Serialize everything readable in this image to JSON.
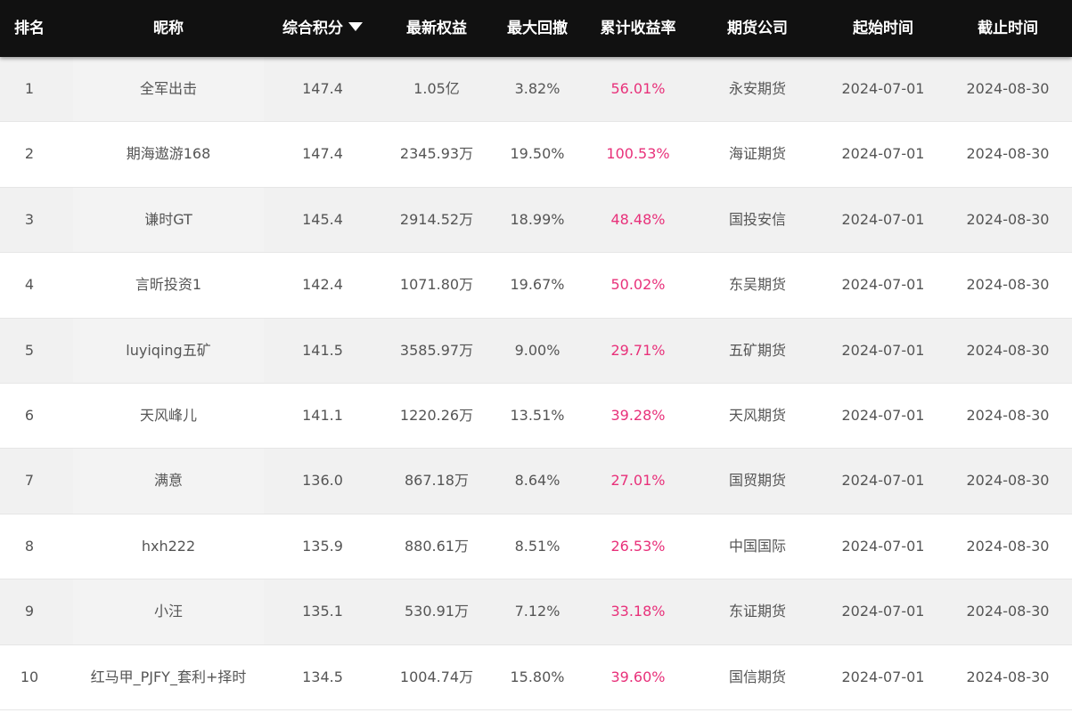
{
  "header": {
    "rank": "排名",
    "nickname": "昵称",
    "score": "综合积分",
    "equity": "最新权益",
    "max_drawdown": "最大回撤",
    "return": "累计收益率",
    "company": "期货公司",
    "start": "起始时间",
    "end": "截止时间",
    "sort_icon": "caret-down-icon"
  },
  "colors": {
    "header_bg": "#111111",
    "row_alt_bg": "#f1f1f1",
    "return_text": "#e8317a",
    "body_text": "#555555"
  },
  "rows": [
    {
      "rank": "1",
      "nickname": "全军出击",
      "score": "147.4",
      "equity": "1.05亿",
      "max_drawdown": "3.82%",
      "return": "56.01%",
      "company": "永安期货",
      "start": "2024-07-01",
      "end": "2024-08-30"
    },
    {
      "rank": "2",
      "nickname": "期海遨游168",
      "score": "147.4",
      "equity": "2345.93万",
      "max_drawdown": "19.50%",
      "return": "100.53%",
      "company": "海证期货",
      "start": "2024-07-01",
      "end": "2024-08-30"
    },
    {
      "rank": "3",
      "nickname": "谦时GT",
      "score": "145.4",
      "equity": "2914.52万",
      "max_drawdown": "18.99%",
      "return": "48.48%",
      "company": "国投安信",
      "start": "2024-07-01",
      "end": "2024-08-30"
    },
    {
      "rank": "4",
      "nickname": "言昕投资1",
      "score": "142.4",
      "equity": "1071.80万",
      "max_drawdown": "19.67%",
      "return": "50.02%",
      "company": "东吴期货",
      "start": "2024-07-01",
      "end": "2024-08-30"
    },
    {
      "rank": "5",
      "nickname": "luyiqing五矿",
      "score": "141.5",
      "equity": "3585.97万",
      "max_drawdown": "9.00%",
      "return": "29.71%",
      "company": "五矿期货",
      "start": "2024-07-01",
      "end": "2024-08-30"
    },
    {
      "rank": "6",
      "nickname": "天风峰儿",
      "score": "141.1",
      "equity": "1220.26万",
      "max_drawdown": "13.51%",
      "return": "39.28%",
      "company": "天风期货",
      "start": "2024-07-01",
      "end": "2024-08-30"
    },
    {
      "rank": "7",
      "nickname": "满意",
      "score": "136.0",
      "equity": "867.18万",
      "max_drawdown": "8.64%",
      "return": "27.01%",
      "company": "国贸期货",
      "start": "2024-07-01",
      "end": "2024-08-30"
    },
    {
      "rank": "8",
      "nickname": "hxh222",
      "score": "135.9",
      "equity": "880.61万",
      "max_drawdown": "8.51%",
      "return": "26.53%",
      "company": "中国国际",
      "start": "2024-07-01",
      "end": "2024-08-30"
    },
    {
      "rank": "9",
      "nickname": "小汪",
      "score": "135.1",
      "equity": "530.91万",
      "max_drawdown": "7.12%",
      "return": "33.18%",
      "company": "东证期货",
      "start": "2024-07-01",
      "end": "2024-08-30"
    },
    {
      "rank": "10",
      "nickname": "红马甲_PJFY_套利+择时",
      "score": "134.5",
      "equity": "1004.74万",
      "max_drawdown": "15.80%",
      "return": "39.60%",
      "company": "国信期货",
      "start": "2024-07-01",
      "end": "2024-08-30"
    }
  ]
}
